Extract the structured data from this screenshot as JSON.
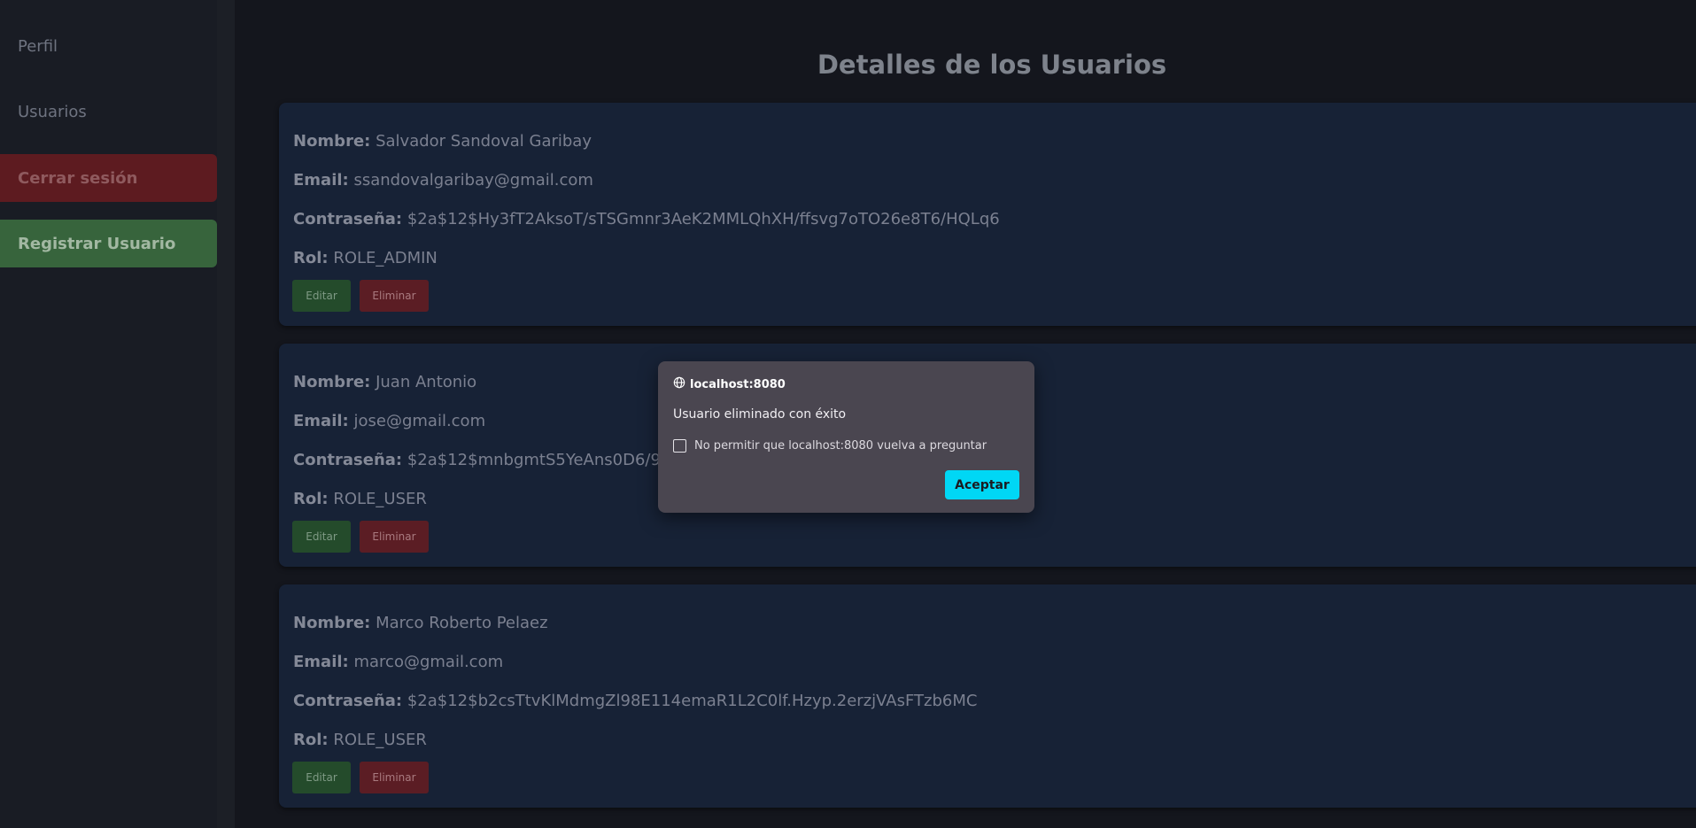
{
  "sidebar": {
    "perfil_label": "Perfil",
    "usuarios_label": "Usuarios",
    "logout_label": "Cerrar sesión",
    "register_label": "Registrar Usuario"
  },
  "main": {
    "title": "Detalles de los Usuarios",
    "field_labels": {
      "name": "Nombre:",
      "email": "Email:",
      "password": "Contraseña:",
      "role": "Rol:"
    },
    "edit_label": "Editar",
    "delete_label": "Eliminar",
    "users": [
      {
        "name": "Salvador Sandoval Garibay",
        "email": "ssandovalgaribay@gmail.com",
        "password": "$2a$12$Hy3fT2AksoT/sTSGmnr3AeK2MMLQhXH/ffsvg7oTO26e8T6/HQLq6",
        "role": "ROLE_ADMIN"
      },
      {
        "name": "Juan Antonio",
        "email": "jose@gmail.com",
        "password": "$2a$12$mnbgmtS5YeAns0D6/93k8",
        "role": "ROLE_USER"
      },
      {
        "name": "Marco Roberto Pelaez",
        "email": "marco@gmail.com",
        "password": "$2a$12$b2csTtvKlMdmgZl98E114emaR1L2C0lf.Hzyp.2erzjVAsFTzb6MC",
        "role": "ROLE_USER"
      }
    ]
  },
  "dialog": {
    "origin": "localhost:8080",
    "message": "Usuario eliminado con éxito",
    "checkbox_label": "No permitir que localhost:8080 vuelva a preguntar",
    "accept_label": "Aceptar",
    "icon": "globe-icon"
  },
  "colors": {
    "accent_accept": "#00d7f5",
    "logout_bg": "#5d1b20",
    "register_bg": "#37643c",
    "card_bg": "#172236"
  }
}
